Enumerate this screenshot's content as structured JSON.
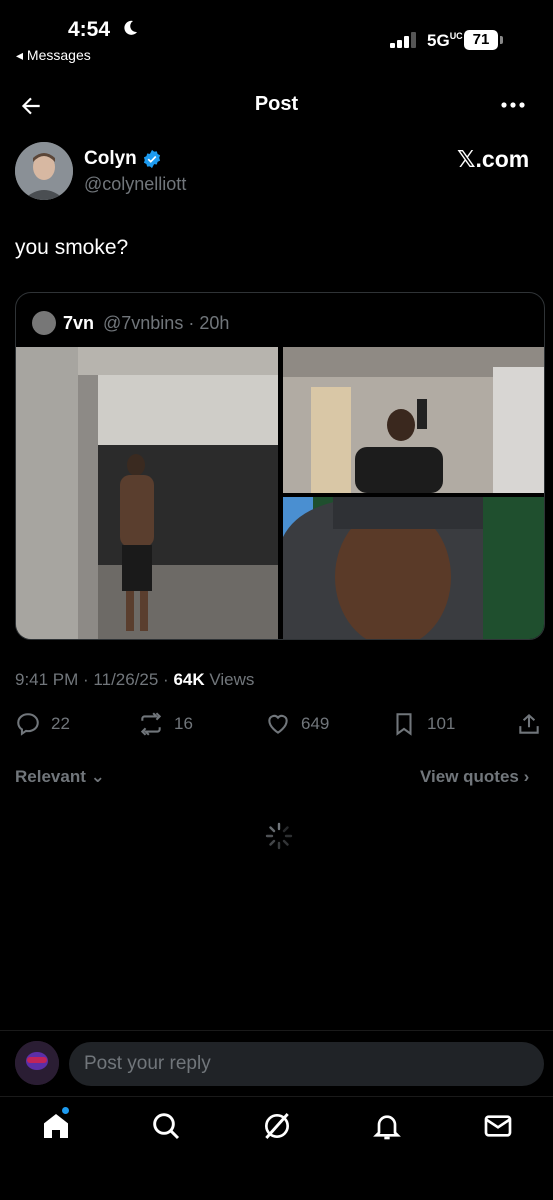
{
  "status_bar": {
    "time": "4:54",
    "back_app": "◂ Messages",
    "network": "5G",
    "network_sup": "UC",
    "battery": "71"
  },
  "nav": {
    "title": "Post"
  },
  "author": {
    "name": "Colyn",
    "handle": "@colynelliott",
    "source": "𝕏.com"
  },
  "post": {
    "text": "you smoke?"
  },
  "quoted": {
    "name": "7vn",
    "handle": "@7vnbins",
    "age": "· 20h"
  },
  "meta": {
    "time": "9:41 PM · 11/26/25 · ",
    "views_count": "64K",
    "views_label": " Views"
  },
  "actions": {
    "replies": "22",
    "reposts": "16",
    "likes": "649",
    "bookmarks": "101"
  },
  "sort": {
    "relevant": "Relevant",
    "view_quotes": "View quotes"
  },
  "reply": {
    "placeholder": "Post your reply"
  },
  "colors": {
    "accent": "#1d9bf0",
    "background": "#000000",
    "muted": "#71767b"
  },
  "icons": [
    "back-arrow-icon",
    "more-icon",
    "verified-icon",
    "reply-icon",
    "repost-icon",
    "like-icon",
    "bookmark-icon",
    "share-icon",
    "chevron-down-icon",
    "chevron-right-icon",
    "home-icon",
    "search-icon",
    "grok-icon",
    "notifications-icon",
    "messages-icon"
  ]
}
